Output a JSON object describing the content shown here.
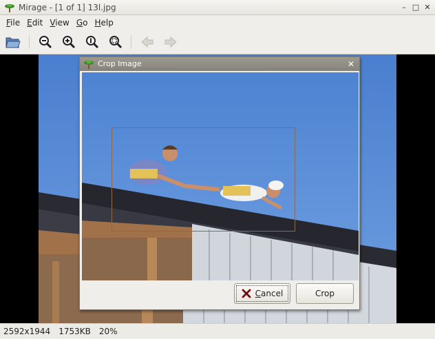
{
  "window": {
    "title": "Mirage - [1 of 1] 13l.jpg",
    "minimize_glyph": "–",
    "maximize_glyph": "□",
    "close_glyph": "✕"
  },
  "menubar": {
    "items": [
      {
        "key": "F",
        "rest": "ile"
      },
      {
        "key": "E",
        "rest": "dit"
      },
      {
        "key": "V",
        "rest": "iew"
      },
      {
        "key": "G",
        "rest": "o"
      },
      {
        "key": "H",
        "rest": "elp"
      }
    ]
  },
  "toolbar": {
    "icons": [
      "open-folder-icon",
      "zoom-out-icon",
      "zoom-in-icon",
      "zoom-1to1-icon",
      "zoom-fit-icon",
      "previous-icon",
      "next-icon"
    ]
  },
  "statusbar": {
    "dimensions": "2592x1944",
    "filesize": "1753KB",
    "zoom": "20%"
  },
  "dialog": {
    "title": "Crop Image",
    "close_glyph": "✕",
    "cancel_key": "C",
    "cancel_rest": "ancel",
    "crop_label": "Crop"
  },
  "colors": {
    "sky": "#5b8fd6",
    "roof_panel": "#27272e",
    "wall": "#d7dbe0",
    "wood": "#a1714a",
    "dialog_title": "#8f8c83",
    "crop_border": "#8a6a48"
  }
}
